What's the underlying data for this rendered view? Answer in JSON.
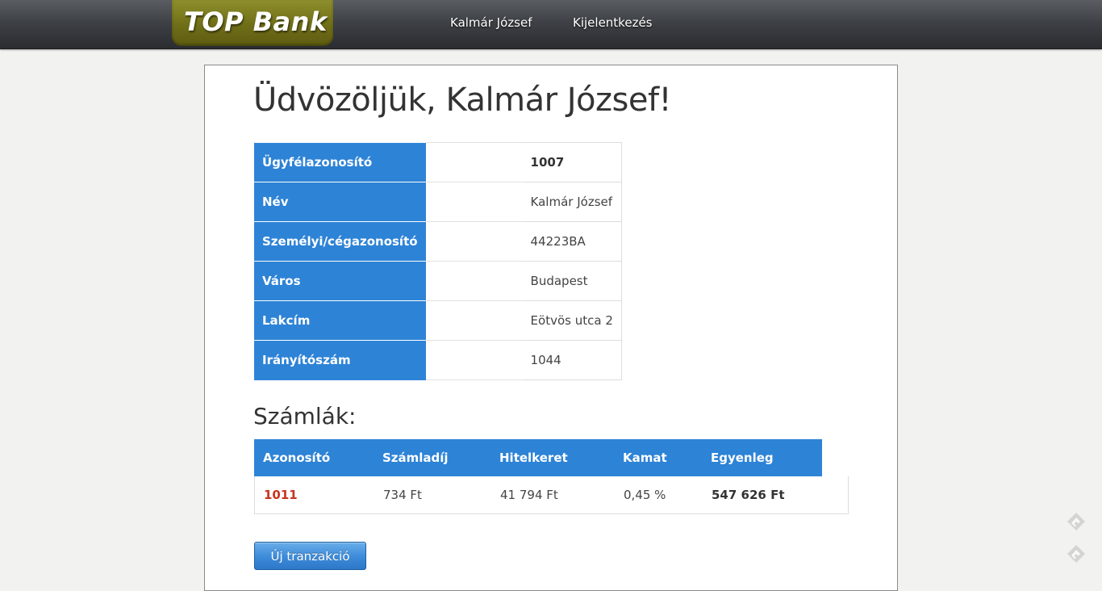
{
  "header": {
    "logo_text": "TOP Bank",
    "nav": {
      "user_label": "Kalmár József",
      "logout_label": "Kijelentkezés"
    }
  },
  "welcome": {
    "title": "Üdvözöljük, Kalmár József!"
  },
  "customer_info": {
    "rows": [
      {
        "label": "Ügyfélazonosító",
        "value": "1007"
      },
      {
        "label": "Név",
        "value": "Kalmár József"
      },
      {
        "label": "Személyi/cégazonosító",
        "value": "44223BA"
      },
      {
        "label": "Város",
        "value": "Budapest"
      },
      {
        "label": "Lakcím",
        "value": "Eötvös utca 2"
      },
      {
        "label": "Irányítószám",
        "value": "1044"
      }
    ]
  },
  "accounts": {
    "title": "Számlák:",
    "columns": [
      "Azonosító",
      "Számladíj",
      "Hitelkeret",
      "Kamat",
      "Egyenleg"
    ],
    "rows": [
      {
        "id": "1011",
        "fee": "734 Ft",
        "credit_limit": "41 794 Ft",
        "interest": "0,45 %",
        "balance": "547 626 Ft"
      }
    ]
  },
  "actions": {
    "new_transaction_label": "Új tranzakció"
  },
  "side_icons": [
    "feedly-icon",
    "feedly-icon"
  ],
  "colors": {
    "accent_blue": "#2d83d6",
    "account_id_red": "#c9331f",
    "logo_olive": "#6f6e18"
  }
}
